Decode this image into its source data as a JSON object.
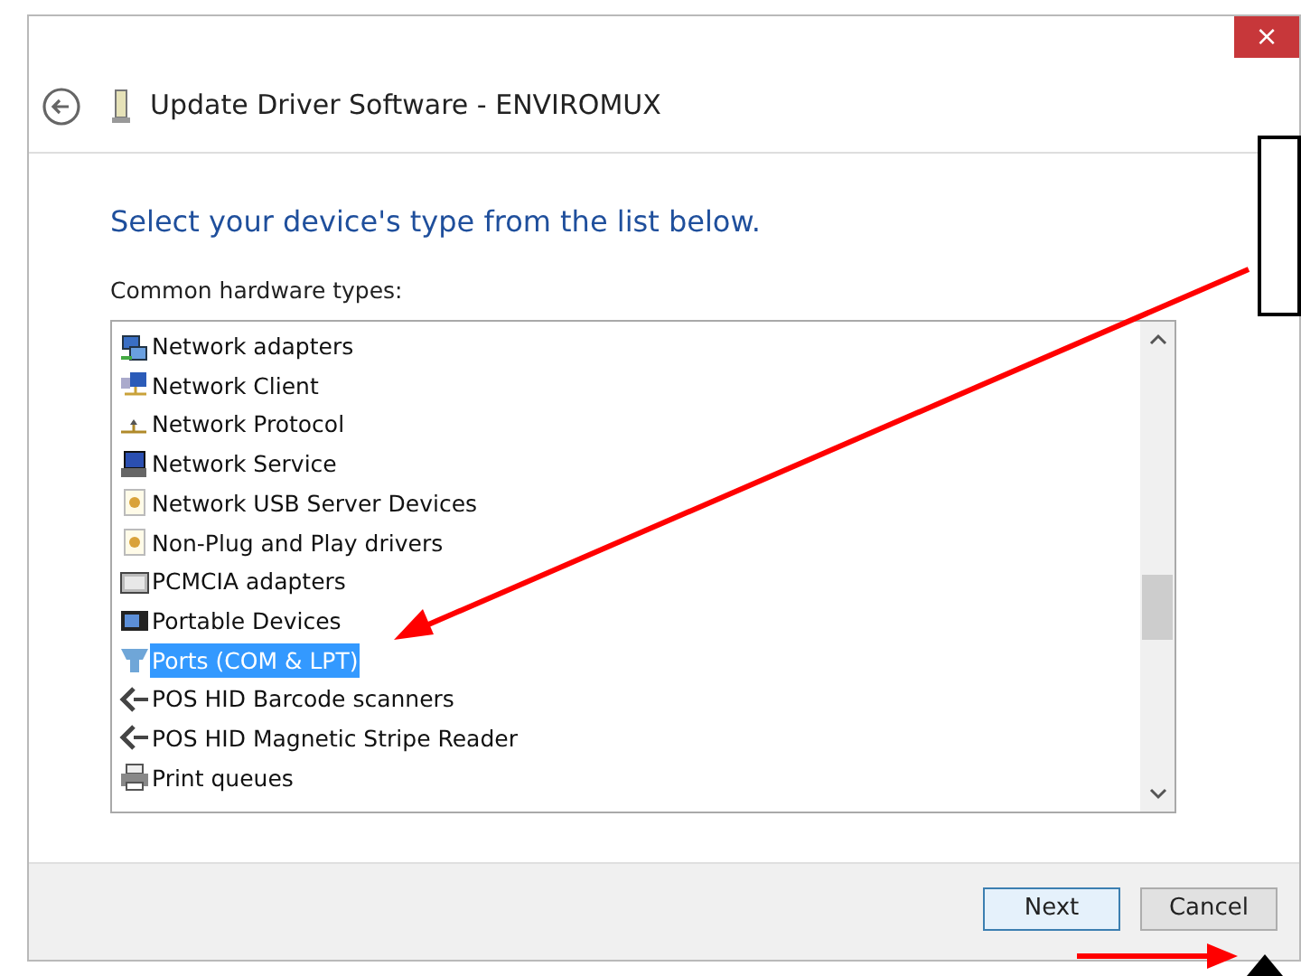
{
  "window": {
    "title": "Update Driver Software - ENVIROMUX",
    "close": "×"
  },
  "heading": "Select your device's type from the list below.",
  "list_label": "Common hardware types:",
  "items": [
    {
      "label": "Network adapters",
      "kind": "adapter",
      "selected": false
    },
    {
      "label": "Network Client",
      "kind": "client",
      "selected": false
    },
    {
      "label": "Network Protocol",
      "kind": "protocol",
      "selected": false
    },
    {
      "label": "Network Service",
      "kind": "service",
      "selected": false
    },
    {
      "label": "Network USB Server Devices",
      "kind": "driver",
      "selected": false
    },
    {
      "label": "Non-Plug and Play drivers",
      "kind": "driver",
      "selected": false
    },
    {
      "label": "PCMCIA adapters",
      "kind": "card",
      "selected": false
    },
    {
      "label": "Portable Devices",
      "kind": "portable",
      "selected": false
    },
    {
      "label": "Ports (COM & LPT)",
      "kind": "port",
      "selected": true
    },
    {
      "label": "POS HID Barcode scanners",
      "kind": "pos",
      "selected": false
    },
    {
      "label": "POS HID Magnetic Stripe Reader",
      "kind": "pos",
      "selected": false
    },
    {
      "label": "Print queues",
      "kind": "printer",
      "selected": false
    }
  ],
  "buttons": [
    {
      "label": "Next",
      "default": true
    },
    {
      "label": "Cancel",
      "default": false
    }
  ]
}
